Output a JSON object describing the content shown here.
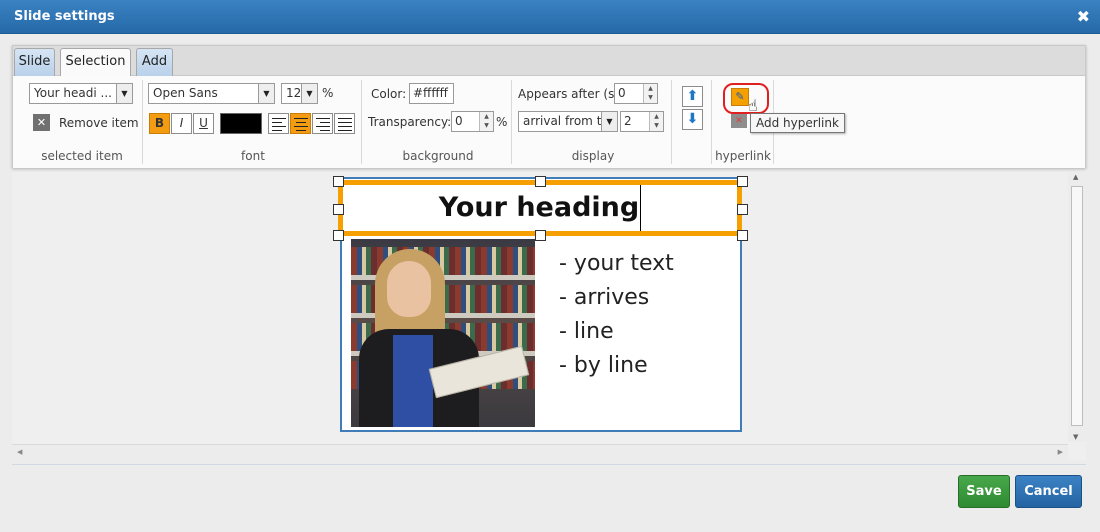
{
  "window": {
    "title": "Slide settings",
    "close_label": "✖"
  },
  "tabs": [
    {
      "label": "Slide"
    },
    {
      "label": "Selection"
    },
    {
      "label": "Add"
    }
  ],
  "selected_item": {
    "dropdown_value": "Your headi ...",
    "remove_label": "Remove item",
    "group_label": "selected item"
  },
  "font": {
    "family_value": "Open Sans",
    "size_value": "12",
    "size_unit": "%",
    "bold_label": "B",
    "italic_label": "I",
    "underline_label": "U",
    "group_label": "font"
  },
  "background": {
    "color_label": "Color:",
    "color_value": "#ffffff",
    "transparency_label": "Transparency:",
    "transparency_value": "0",
    "transparency_unit": "%",
    "group_label": "background"
  },
  "display": {
    "appears_label": "Appears after (s):",
    "appears_value": "0",
    "arrival_value": "arrival from to",
    "arrival_spin_value": "2",
    "group_label": "display"
  },
  "hyperlink": {
    "group_label": "hyperlink",
    "tooltip": "Add hyperlink"
  },
  "slide": {
    "heading": "Your heading",
    "bullets": [
      "- your text",
      "- arrives",
      "- line",
      "- by line"
    ]
  },
  "footer": {
    "save_label": "Save",
    "cancel_label": "Cancel"
  },
  "colors": {
    "titlebar": "#2b72b5",
    "selection_outline": "#f5a000",
    "save": "#3a9a3c",
    "cancel": "#2c6fb0"
  },
  "icons": {
    "close": "close-icon",
    "remove": "remove-x-icon",
    "move_up": "arrow-up-icon",
    "move_down": "arrow-down-icon",
    "add_hyperlink": "link-add-icon",
    "remove_hyperlink": "link-remove-icon",
    "cursor": "hand-cursor-icon"
  }
}
